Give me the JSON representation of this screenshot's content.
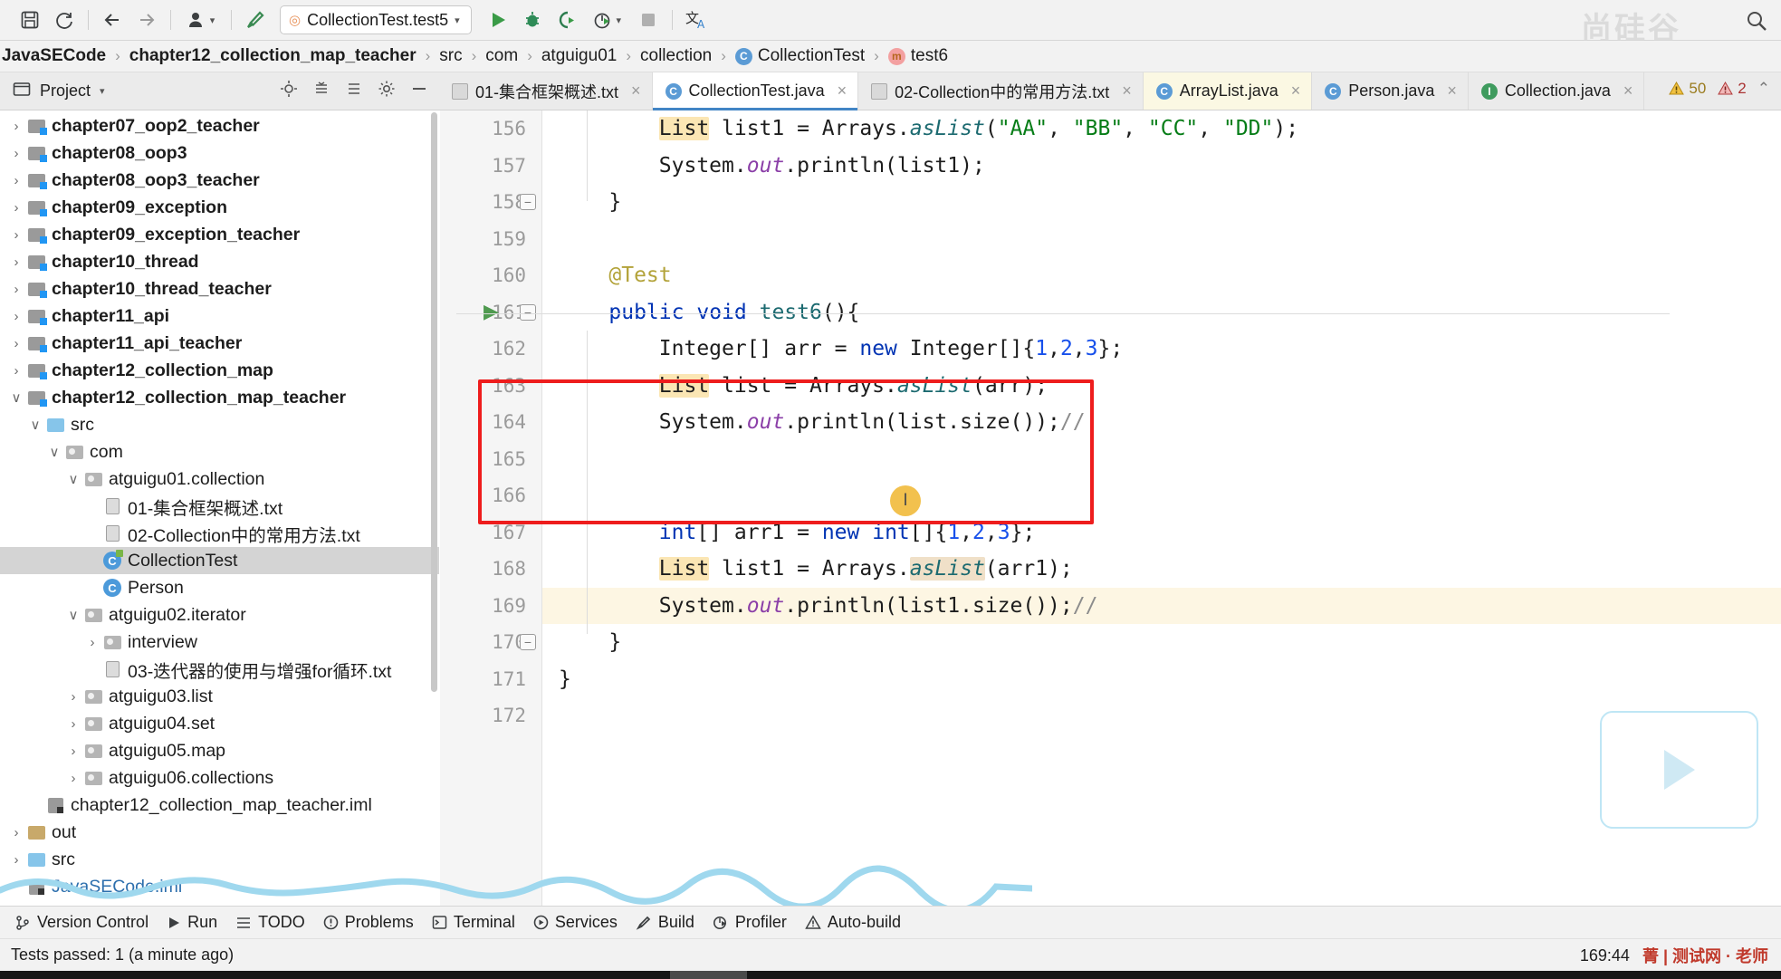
{
  "toolbar": {
    "icons": [
      "save-icon",
      "sync-icon",
      "back-arrow-icon",
      "forward-arrow-icon",
      "user-icon",
      "build-hammer-icon"
    ],
    "run_config": {
      "label": "CollectionTest.test5",
      "dropdown": "▾"
    },
    "run_label": "Run",
    "debug_label": "Debug",
    "coverage_label": "Run with Coverage",
    "profiler_label": "Profile",
    "stop_label": "Stop",
    "translate_label": "Translate",
    "watermark": "尚硅谷"
  },
  "breadcrumb": {
    "items": [
      {
        "label": "JavaSECode",
        "bold": true,
        "icon": ""
      },
      {
        "label": "chapter12_collection_map_teacher",
        "bold": true,
        "icon": ""
      },
      {
        "label": "src",
        "bold": false,
        "icon": ""
      },
      {
        "label": "com",
        "bold": false,
        "icon": ""
      },
      {
        "label": "atguigu01",
        "bold": false,
        "icon": ""
      },
      {
        "label": "collection",
        "bold": false,
        "icon": ""
      },
      {
        "label": "CollectionTest",
        "bold": false,
        "icon": "class-icon"
      },
      {
        "label": "test6",
        "bold": false,
        "icon": "method-icon"
      }
    ],
    "separator": "›"
  },
  "project_panel": {
    "title": "Project",
    "dropdown": "▾",
    "icons": [
      "locate-icon",
      "collapse-all-icon",
      "expand-all-icon",
      "settings-gear-icon",
      "hide-icon"
    ]
  },
  "editor_tabs": [
    {
      "label": "01-集合框架概述.txt",
      "icon": "text-file-icon",
      "active": false,
      "highlight": false
    },
    {
      "label": "CollectionTest.java",
      "icon": "java-test-class-icon",
      "active": true,
      "highlight": false
    },
    {
      "label": "02-Collection中的常用方法.txt",
      "icon": "text-file-icon",
      "active": false,
      "highlight": false
    },
    {
      "label": "ArrayList.java",
      "icon": "java-class-icon",
      "active": false,
      "highlight": true
    },
    {
      "label": "Person.java",
      "icon": "java-class-icon",
      "active": false,
      "highlight": false
    },
    {
      "label": "Collection.java",
      "icon": "java-interface-icon",
      "active": false,
      "highlight": false
    }
  ],
  "tab_close_glyph": "×",
  "inspections": {
    "warnings": "50",
    "errors": "2",
    "chevron": "⌃"
  },
  "tree": [
    {
      "indent": 0,
      "arrow": "›",
      "icon": "module-folder-icon",
      "label": "chapter07_oop2_teacher",
      "bold": true,
      "selected": false
    },
    {
      "indent": 0,
      "arrow": "›",
      "icon": "module-folder-icon",
      "label": "chapter08_oop3",
      "bold": true,
      "selected": false
    },
    {
      "indent": 0,
      "arrow": "›",
      "icon": "module-folder-icon",
      "label": "chapter08_oop3_teacher",
      "bold": true,
      "selected": false
    },
    {
      "indent": 0,
      "arrow": "›",
      "icon": "module-folder-icon",
      "label": "chapter09_exception",
      "bold": true,
      "selected": false
    },
    {
      "indent": 0,
      "arrow": "›",
      "icon": "module-folder-icon",
      "label": "chapter09_exception_teacher",
      "bold": true,
      "selected": false
    },
    {
      "indent": 0,
      "arrow": "›",
      "icon": "module-folder-icon",
      "label": "chapter10_thread",
      "bold": true,
      "selected": false
    },
    {
      "indent": 0,
      "arrow": "›",
      "icon": "module-folder-icon",
      "label": "chapter10_thread_teacher",
      "bold": true,
      "selected": false
    },
    {
      "indent": 0,
      "arrow": "›",
      "icon": "module-folder-icon",
      "label": "chapter11_api",
      "bold": true,
      "selected": false
    },
    {
      "indent": 0,
      "arrow": "›",
      "icon": "module-folder-icon",
      "label": "chapter11_api_teacher",
      "bold": true,
      "selected": false
    },
    {
      "indent": 0,
      "arrow": "›",
      "icon": "module-folder-icon",
      "label": "chapter12_collection_map",
      "bold": true,
      "selected": false
    },
    {
      "indent": 0,
      "arrow": "∨",
      "icon": "module-folder-icon",
      "label": "chapter12_collection_map_teacher",
      "bold": true,
      "selected": false
    },
    {
      "indent": 1,
      "arrow": "∨",
      "icon": "source-folder-icon",
      "label": "src",
      "bold": false,
      "selected": false
    },
    {
      "indent": 2,
      "arrow": "∨",
      "icon": "package-folder-icon",
      "label": "com",
      "bold": false,
      "selected": false
    },
    {
      "indent": 3,
      "arrow": "∨",
      "icon": "package-folder-icon",
      "label": "atguigu01.collection",
      "bold": false,
      "selected": false
    },
    {
      "indent": 4,
      "arrow": "",
      "icon": "text-file-icon",
      "label": "01-集合框架概述.txt",
      "bold": false,
      "selected": false
    },
    {
      "indent": 4,
      "arrow": "",
      "icon": "text-file-icon",
      "label": "02-Collection中的常用方法.txt",
      "bold": false,
      "selected": false
    },
    {
      "indent": 4,
      "arrow": "",
      "icon": "java-test-class-icon",
      "label": "CollectionTest",
      "bold": false,
      "selected": true
    },
    {
      "indent": 4,
      "arrow": "",
      "icon": "java-class-icon",
      "label": "Person",
      "bold": false,
      "selected": false
    },
    {
      "indent": 3,
      "arrow": "∨",
      "icon": "package-folder-icon",
      "label": "atguigu02.iterator",
      "bold": false,
      "selected": false
    },
    {
      "indent": 4,
      "arrow": "›",
      "icon": "package-folder-icon",
      "label": "interview",
      "bold": false,
      "selected": false
    },
    {
      "indent": 4,
      "arrow": "",
      "icon": "text-file-icon",
      "label": "03-迭代器的使用与增强for循环.txt",
      "bold": false,
      "selected": false
    },
    {
      "indent": 3,
      "arrow": "›",
      "icon": "package-folder-icon",
      "label": "atguigu03.list",
      "bold": false,
      "selected": false
    },
    {
      "indent": 3,
      "arrow": "›",
      "icon": "package-folder-icon",
      "label": "atguigu04.set",
      "bold": false,
      "selected": false
    },
    {
      "indent": 3,
      "arrow": "›",
      "icon": "package-folder-icon",
      "label": "atguigu05.map",
      "bold": false,
      "selected": false
    },
    {
      "indent": 3,
      "arrow": "›",
      "icon": "package-folder-icon",
      "label": "atguigu06.collections",
      "bold": false,
      "selected": false
    },
    {
      "indent": 1,
      "arrow": "",
      "icon": "iml-file-icon",
      "label": "chapter12_collection_map_teacher.iml",
      "bold": false,
      "selected": false
    },
    {
      "indent": 0,
      "arrow": "›",
      "icon": "out-folder-icon",
      "label": "out",
      "bold": false,
      "selected": false
    },
    {
      "indent": 0,
      "arrow": "›",
      "icon": "source-folder-icon",
      "label": "src",
      "bold": false,
      "selected": false
    },
    {
      "indent": 0,
      "arrow": "",
      "icon": "iml-file-icon",
      "label": "JavaSECode.iml",
      "bold": false,
      "selected": false,
      "blue": true
    }
  ],
  "editor": {
    "first_line_number": 156,
    "lines": [
      {
        "num": "156",
        "fold": false,
        "run": false,
        "current": false,
        "tokens": [
          {
            "t": "        ",
            "c": ""
          },
          {
            "t": "List",
            "c": "hl-ident"
          },
          {
            "t": " list1 = Arrays.",
            "c": ""
          },
          {
            "t": "asList",
            "c": "mth-italic"
          },
          {
            "t": "(",
            "c": ""
          },
          {
            "t": "\"AA\"",
            "c": "str"
          },
          {
            "t": ", ",
            "c": ""
          },
          {
            "t": "\"BB\"",
            "c": "str"
          },
          {
            "t": ", ",
            "c": ""
          },
          {
            "t": "\"CC\"",
            "c": "str"
          },
          {
            "t": ", ",
            "c": ""
          },
          {
            "t": "\"DD\"",
            "c": "str"
          },
          {
            "t": ");",
            "c": ""
          }
        ]
      },
      {
        "num": "157",
        "fold": false,
        "run": false,
        "current": false,
        "tokens": [
          {
            "t": "        System.",
            "c": ""
          },
          {
            "t": "out",
            "c": "stat"
          },
          {
            "t": ".println(list1);",
            "c": ""
          }
        ]
      },
      {
        "num": "158",
        "fold": true,
        "run": false,
        "current": false,
        "tokens": [
          {
            "t": "    }",
            "c": ""
          }
        ]
      },
      {
        "num": "159",
        "fold": false,
        "run": false,
        "current": false,
        "tokens": []
      },
      {
        "num": "160",
        "fold": false,
        "run": false,
        "current": false,
        "tokens": [
          {
            "t": "    ",
            "c": ""
          },
          {
            "t": "@Test",
            "c": "anno"
          }
        ]
      },
      {
        "num": "161",
        "fold": true,
        "run": true,
        "current": false,
        "tokens": [
          {
            "t": "    ",
            "c": ""
          },
          {
            "t": "public",
            "c": "kw"
          },
          {
            "t": " ",
            "c": ""
          },
          {
            "t": "void",
            "c": "kw"
          },
          {
            "t": " ",
            "c": ""
          },
          {
            "t": "test6",
            "c": "mth"
          },
          {
            "t": "(){",
            "c": ""
          }
        ]
      },
      {
        "num": "162",
        "fold": false,
        "run": false,
        "current": false,
        "tokens": [
          {
            "t": "        Integer[] arr = ",
            "c": ""
          },
          {
            "t": "new",
            "c": "kw"
          },
          {
            "t": " Integer[]{",
            "c": ""
          },
          {
            "t": "1",
            "c": "num"
          },
          {
            "t": ",",
            "c": ""
          },
          {
            "t": "2",
            "c": "num"
          },
          {
            "t": ",",
            "c": ""
          },
          {
            "t": "3",
            "c": "num"
          },
          {
            "t": "};",
            "c": ""
          }
        ]
      },
      {
        "num": "163",
        "fold": false,
        "run": false,
        "current": false,
        "tokens": [
          {
            "t": "        ",
            "c": ""
          },
          {
            "t": "List",
            "c": "hl-ident"
          },
          {
            "t": " list = Arrays.",
            "c": ""
          },
          {
            "t": "asList",
            "c": "mth-italic"
          },
          {
            "t": "(arr);",
            "c": ""
          }
        ]
      },
      {
        "num": "164",
        "fold": false,
        "run": false,
        "current": false,
        "tokens": [
          {
            "t": "        System.",
            "c": ""
          },
          {
            "t": "out",
            "c": "stat"
          },
          {
            "t": ".println(list.size());",
            "c": ""
          },
          {
            "t": "//",
            "c": "cmt"
          }
        ]
      },
      {
        "num": "165",
        "fold": false,
        "run": false,
        "current": false,
        "tokens": []
      },
      {
        "num": "166",
        "fold": false,
        "run": false,
        "current": false,
        "tokens": []
      },
      {
        "num": "167",
        "fold": false,
        "run": false,
        "current": false,
        "tokens": [
          {
            "t": "        ",
            "c": ""
          },
          {
            "t": "int",
            "c": "kw"
          },
          {
            "t": "[] arr1 = ",
            "c": ""
          },
          {
            "t": "new",
            "c": "kw"
          },
          {
            "t": " ",
            "c": ""
          },
          {
            "t": "int",
            "c": "kw"
          },
          {
            "t": "[]{",
            "c": ""
          },
          {
            "t": "1",
            "c": "num"
          },
          {
            "t": ",",
            "c": ""
          },
          {
            "t": "2",
            "c": "num"
          },
          {
            "t": ",",
            "c": ""
          },
          {
            "t": "3",
            "c": "num"
          },
          {
            "t": "};",
            "c": ""
          }
        ]
      },
      {
        "num": "168",
        "fold": false,
        "run": false,
        "current": false,
        "tokens": [
          {
            "t": "        ",
            "c": ""
          },
          {
            "t": "List",
            "c": "hl-ident"
          },
          {
            "t": " list1 = Arrays.",
            "c": ""
          },
          {
            "t": "asList",
            "c": "hl-mth"
          },
          {
            "t": "(arr1);",
            "c": ""
          }
        ]
      },
      {
        "num": "169",
        "fold": false,
        "run": false,
        "current": true,
        "tokens": [
          {
            "t": "        System.",
            "c": ""
          },
          {
            "t": "out",
            "c": "stat"
          },
          {
            "t": ".println(list1.size());",
            "c": ""
          },
          {
            "t": "//",
            "c": "cmt"
          }
        ]
      },
      {
        "num": "170",
        "fold": true,
        "run": false,
        "current": false,
        "tokens": [
          {
            "t": "    }",
            "c": ""
          }
        ]
      },
      {
        "num": "171",
        "fold": false,
        "run": false,
        "current": false,
        "tokens": [
          {
            "t": "}",
            "c": ""
          }
        ]
      },
      {
        "num": "172",
        "fold": false,
        "run": false,
        "current": false,
        "tokens": []
      }
    ]
  },
  "tool_window_bar": [
    {
      "label": "Version Control",
      "icon": "branch-icon"
    },
    {
      "label": "Run",
      "icon": "play-icon"
    },
    {
      "label": "TODO",
      "icon": "list-icon"
    },
    {
      "label": "Problems",
      "icon": "error-circle-icon"
    },
    {
      "label": "Terminal",
      "icon": "terminal-icon"
    },
    {
      "label": "Services",
      "icon": "services-icon"
    },
    {
      "label": "Build",
      "icon": "hammer-icon"
    },
    {
      "label": "Profiler",
      "icon": "profiler-icon"
    },
    {
      "label": "Auto-build",
      "icon": "warning-triangle-icon"
    }
  ],
  "status_bar": {
    "message": "Tests passed: 1 (a minute ago)",
    "caret_position": "169:44",
    "watermark": "菁 | 测试网 · 老师"
  }
}
